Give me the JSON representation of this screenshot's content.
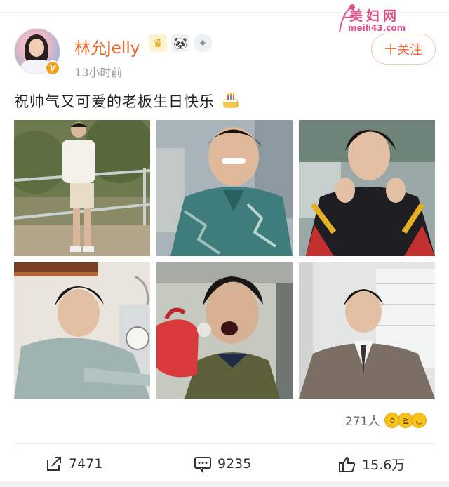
{
  "watermark": {
    "site_name": "美妇网",
    "site_url": "meili43.com"
  },
  "post": {
    "author": {
      "name": "林允Jelly",
      "verified_badge": "V",
      "badges": [
        "crown-badge",
        "panda-badge",
        "medal-badge"
      ]
    },
    "time": "13小时前",
    "follow_label": "十关注",
    "text": "祝帅气又可爱的老板生日快乐",
    "text_emoji": "birthday-cake-icon",
    "photos_count": 6
  },
  "reactions": {
    "count": "271人",
    "emojis": [
      "surprised-emoji",
      "laughing-emoji",
      "grin-emoji"
    ]
  },
  "actions": {
    "share_count": "7471",
    "comment_count": "9235",
    "like_count": "15.6万"
  },
  "colors": {
    "accent": "#e8662a",
    "follow_border": "#f0c9a8",
    "muted_text": "#999999",
    "watermark": "#e0508a"
  }
}
